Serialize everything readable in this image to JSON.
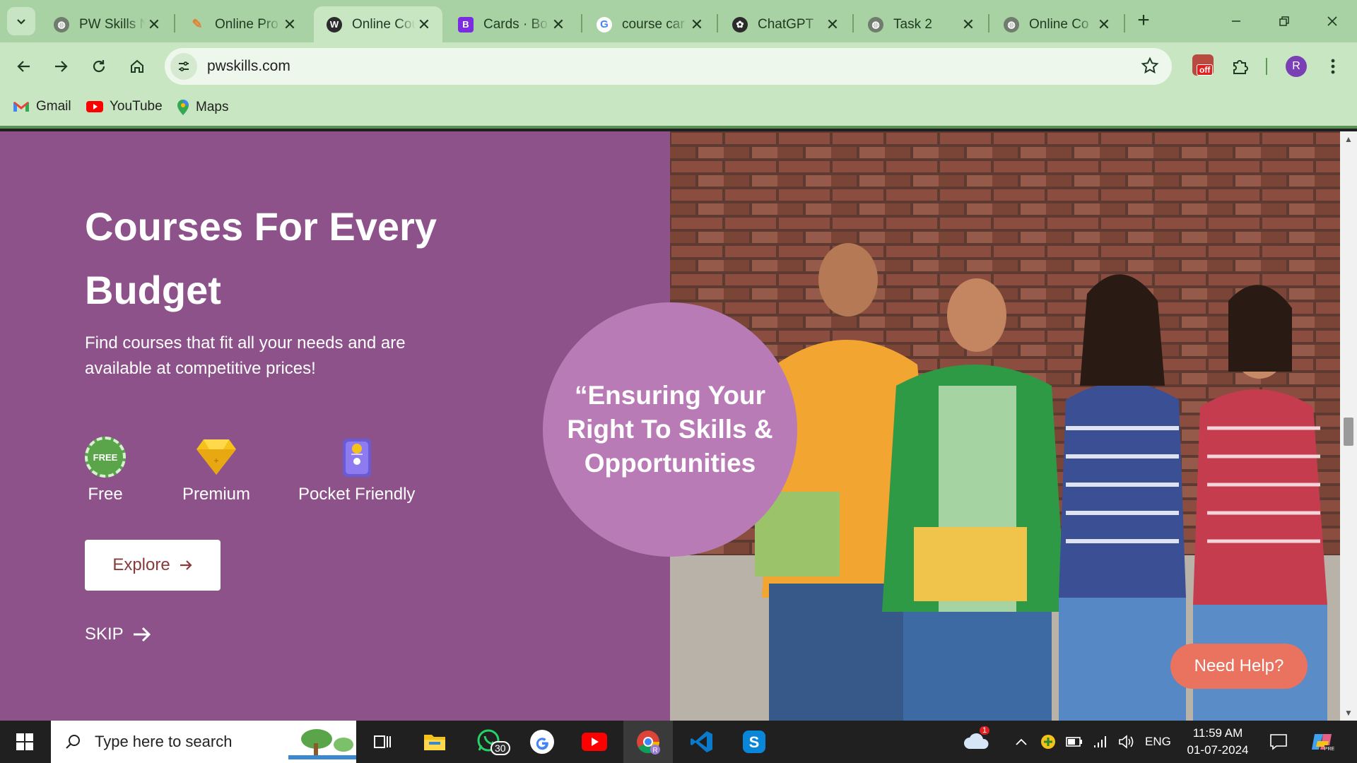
{
  "browser": {
    "tabs": [
      {
        "title": "PW Skills N",
        "favicon": "globe-icon"
      },
      {
        "title": "Online Pro",
        "favicon": "feather-icon"
      },
      {
        "title": "Online Cou",
        "favicon": "wordpress-icon",
        "active": true
      },
      {
        "title": "Cards · Bo",
        "favicon": "bootstrap-icon"
      },
      {
        "title": "course car",
        "favicon": "google-icon"
      },
      {
        "title": "ChatGPT",
        "favicon": "openai-icon"
      },
      {
        "title": "Task 2",
        "favicon": "globe-icon"
      },
      {
        "title": "Online Co",
        "favicon": "globe-icon"
      }
    ],
    "url": "pwskills.com",
    "extension_badge": "off",
    "profile_initial": "R",
    "bookmarks": [
      {
        "label": "Gmail",
        "icon": "gmail-icon"
      },
      {
        "label": "YouTube",
        "icon": "youtube-icon"
      },
      {
        "label": "Maps",
        "icon": "maps-icon"
      }
    ]
  },
  "hero": {
    "title_line1": "Courses For Every",
    "title_line2": "Budget",
    "subtitle": "Find courses that fit all your needs and are available at competitive prices!",
    "features": [
      {
        "label": "Free",
        "badge": "FREE"
      },
      {
        "label": "Premium"
      },
      {
        "label": "Pocket Friendly"
      }
    ],
    "explore_label": "Explore",
    "skip_label": "SKIP",
    "quote": "“Ensuring Your Right To Skills & Opportunities",
    "help_label": "Need Help?"
  },
  "taskbar": {
    "search_placeholder": "Type here to search",
    "whatsapp_badge": "30",
    "weather_badge": "1",
    "language": "ENG",
    "time": "11:59 AM",
    "date": "01-07-2024"
  },
  "colors": {
    "hero_bg": "#8c5289",
    "quote_circle": "#b97bb6",
    "help_button": "#e9735f",
    "browser_frame": "#a8d2a3"
  }
}
